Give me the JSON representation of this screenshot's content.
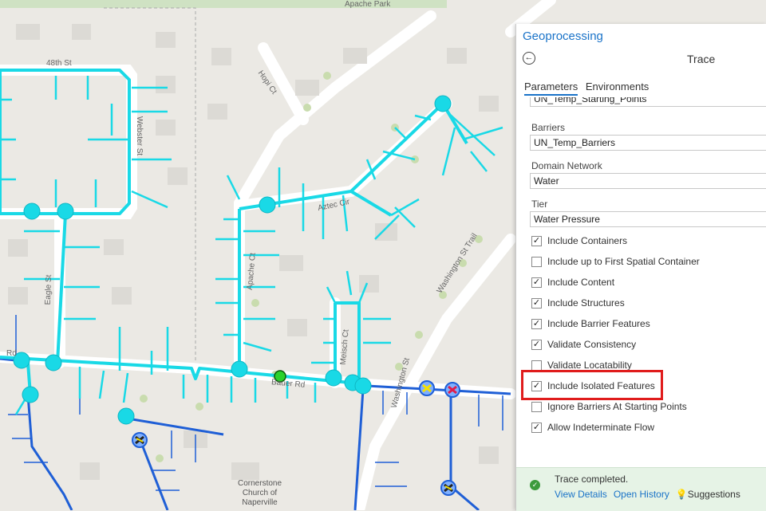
{
  "map": {
    "labels": {
      "apache_park": "Apache Park",
      "street_48th": "48th St",
      "hopi_ct": "Hopi Ct",
      "webster_st": "Webster St",
      "aztec_cir": "Aztec Cir",
      "washington_st_trail": "Washington St Trail",
      "apache_ct": "Apache Ct",
      "eagle_st": "Eagle St",
      "meisch_ct": "Meisch Ct",
      "washington_st": "Washington St",
      "bauer_rd": "Bauer Rd",
      "rd": "Rd",
      "church": [
        "Cornerstone",
        "Church of",
        "Naperville"
      ]
    }
  },
  "panel": {
    "title": "Geoprocessing",
    "tool_title": "Trace",
    "tabs": [
      "Parameters",
      "Environments"
    ],
    "parameters": {
      "starting_points_value": "UN_Temp_Starting_Points",
      "barriers_label": "Barriers",
      "barriers_value": "UN_Temp_Barriers",
      "domain_network_label": "Domain Network",
      "domain_network_value": "Water",
      "tier_label": "Tier",
      "tier_value": "Water Pressure"
    },
    "checkboxes": [
      {
        "label": "Include Containers",
        "checked": true
      },
      {
        "label": "Include up to First Spatial Container",
        "checked": false
      },
      {
        "label": "Include Content",
        "checked": true
      },
      {
        "label": "Include Structures",
        "checked": true
      },
      {
        "label": "Include Barrier Features",
        "checked": true
      },
      {
        "label": "Validate Consistency",
        "checked": true
      },
      {
        "label": "Validate Locatability",
        "checked": false
      },
      {
        "label": "Include Isolated Features",
        "checked": true
      },
      {
        "label": "Ignore Barriers At Starting Points",
        "checked": false
      },
      {
        "label": "Allow Indeterminate Flow",
        "checked": true
      }
    ],
    "status": {
      "message": "Trace completed.",
      "view_details": "View Details",
      "open_history": "Open History",
      "suggestions": "Suggestions"
    }
  },
  "colors": {
    "trace_highlight": "#19d9e6",
    "water_main": "#1f5fd6",
    "accent": "#1a73c8",
    "callout": "#e01c1c",
    "status_bg": "#e6f3e6"
  }
}
